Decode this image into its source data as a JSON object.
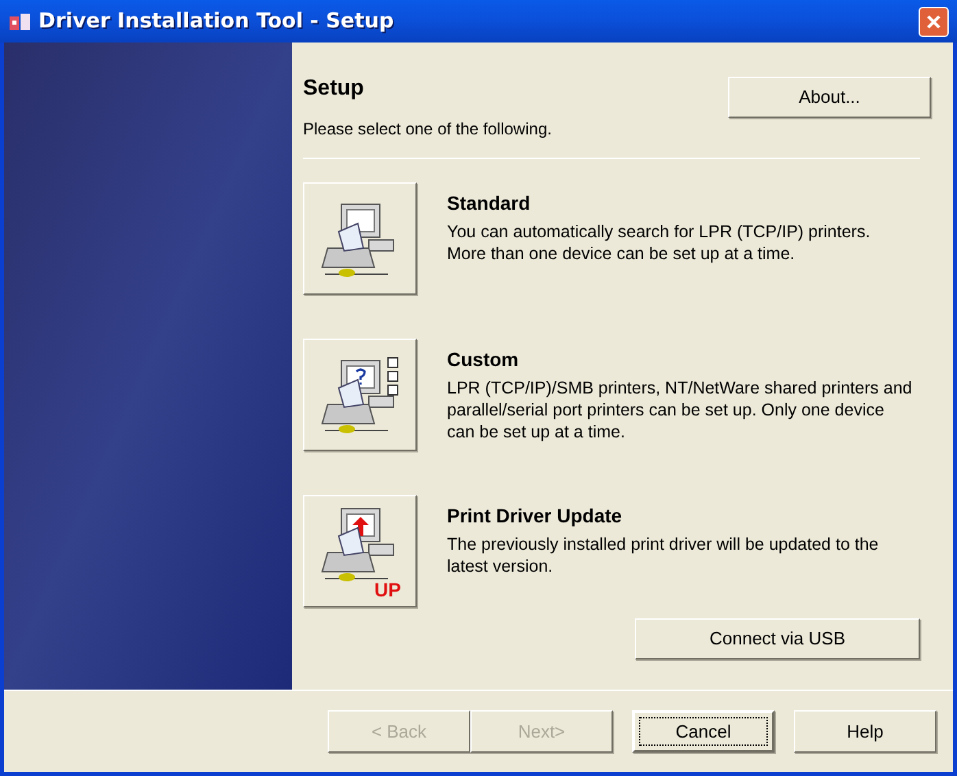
{
  "window": {
    "title": "Driver Installation Tool - Setup"
  },
  "header": {
    "title": "Setup",
    "subtitle": "Please select one of the following.",
    "about_button": {
      "label": "About..."
    }
  },
  "options": [
    {
      "kind": "standard",
      "title": "Standard",
      "description": "You can automatically search for LPR (TCP/IP) printers. More than one device can be set up at a time."
    },
    {
      "kind": "custom",
      "title": "Custom",
      "description": "LPR (TCP/IP)/SMB printers, NT/NetWare shared printers and parallel/serial port printers can be set up. Only one device can be set up at a time."
    },
    {
      "kind": "update",
      "title": "Print Driver Update",
      "description": "The previously installed print driver will be updated to the latest version.",
      "badge": "UP"
    }
  ],
  "usb_button": {
    "label": "Connect via USB"
  },
  "footer_buttons": [
    {
      "label": "< Back",
      "disabled": true,
      "focused": false
    },
    {
      "label": "Next>",
      "disabled": true,
      "focused": false
    },
    {
      "label": "Cancel",
      "disabled": false,
      "focused": true
    },
    {
      "label": "Help",
      "disabled": false,
      "focused": false
    }
  ]
}
